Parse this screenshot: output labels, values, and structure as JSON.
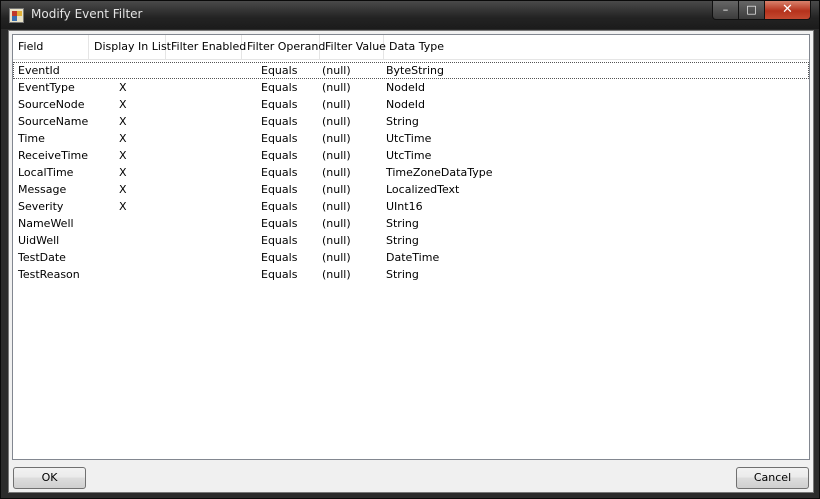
{
  "window": {
    "title": "Modify Event Filter",
    "controls": {
      "minimize": "–",
      "maximize": "□",
      "close": "✕"
    }
  },
  "columns": [
    "Field",
    "Display In List",
    "Filter Enabled",
    "Filter Operand",
    "Filter Value",
    "Data Type"
  ],
  "rows": [
    {
      "field": "EventId",
      "display": "",
      "enabled": "",
      "operand": "Equals",
      "value": "(null)",
      "type": "ByteString"
    },
    {
      "field": "EventType",
      "display": "X",
      "enabled": "",
      "operand": "Equals",
      "value": "(null)",
      "type": "NodeId"
    },
    {
      "field": "SourceNode",
      "display": "X",
      "enabled": "",
      "operand": "Equals",
      "value": "(null)",
      "type": "NodeId"
    },
    {
      "field": "SourceName",
      "display": "X",
      "enabled": "",
      "operand": "Equals",
      "value": "(null)",
      "type": "String"
    },
    {
      "field": "Time",
      "display": "X",
      "enabled": "",
      "operand": "Equals",
      "value": "(null)",
      "type": "UtcTime"
    },
    {
      "field": "ReceiveTime",
      "display": "X",
      "enabled": "",
      "operand": "Equals",
      "value": "(null)",
      "type": "UtcTime"
    },
    {
      "field": "LocalTime",
      "display": "X",
      "enabled": "",
      "operand": "Equals",
      "value": "(null)",
      "type": "TimeZoneDataType"
    },
    {
      "field": "Message",
      "display": "X",
      "enabled": "",
      "operand": "Equals",
      "value": "(null)",
      "type": "LocalizedText"
    },
    {
      "field": "Severity",
      "display": "X",
      "enabled": "",
      "operand": "Equals",
      "value": "(null)",
      "type": "UInt16"
    },
    {
      "field": "NameWell",
      "display": "",
      "enabled": "",
      "operand": "Equals",
      "value": "(null)",
      "type": "String"
    },
    {
      "field": "UidWell",
      "display": "",
      "enabled": "",
      "operand": "Equals",
      "value": "(null)",
      "type": "String"
    },
    {
      "field": "TestDate",
      "display": "",
      "enabled": "",
      "operand": "Equals",
      "value": "(null)",
      "type": "DateTime"
    },
    {
      "field": "TestReason",
      "display": "",
      "enabled": "",
      "operand": "Equals",
      "value": "(null)",
      "type": "String"
    }
  ],
  "buttons": {
    "ok": "OK",
    "cancel": "Cancel"
  }
}
